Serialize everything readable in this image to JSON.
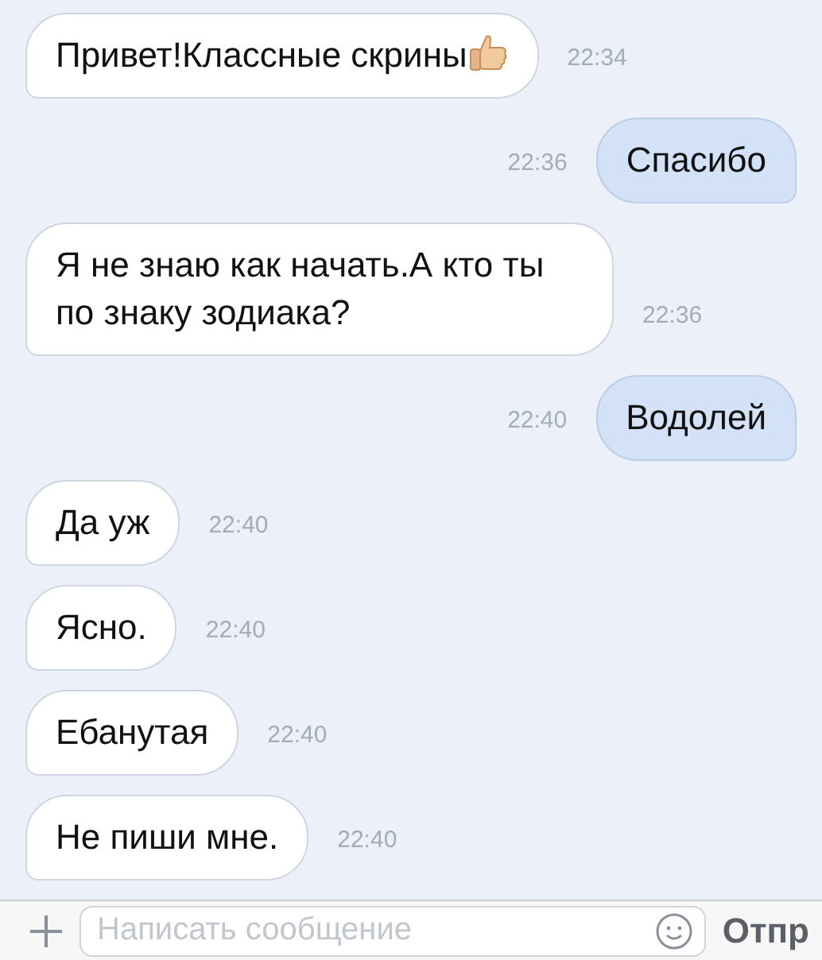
{
  "messages": [
    {
      "kind": "incoming",
      "text": "Привет!Классные скрины",
      "emoji": true,
      "time": "22:34"
    },
    {
      "kind": "outgoing",
      "text": "Спасибо",
      "emoji": false,
      "time": "22:36"
    },
    {
      "kind": "incoming",
      "text": "Я не знаю как начать.А кто ты по знаку зодиака?",
      "emoji": false,
      "time": "22:36"
    },
    {
      "kind": "outgoing",
      "text": "Водолей",
      "emoji": false,
      "time": "22:40"
    },
    {
      "kind": "incoming",
      "text": "Да уж",
      "emoji": false,
      "time": "22:40"
    },
    {
      "kind": "incoming",
      "text": "Ясно.",
      "emoji": false,
      "time": "22:40"
    },
    {
      "kind": "incoming",
      "text": "Ебанутая",
      "emoji": false,
      "time": "22:40"
    },
    {
      "kind": "incoming",
      "text": "Не пиши мне.",
      "emoji": false,
      "time": "22:40"
    }
  ],
  "composer": {
    "placeholder": "Написать сообщение",
    "send": "Отпр"
  }
}
